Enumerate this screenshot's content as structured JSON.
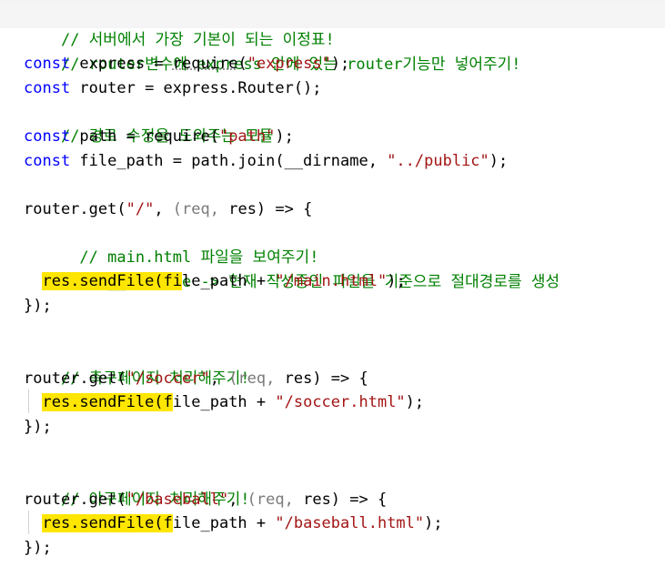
{
  "colors": {
    "background": "#ffffff",
    "comment": "#008000",
    "keyword": "#0000ff",
    "string": "#a31515",
    "plain": "#000000",
    "faded_param": "#7a7a7a",
    "highlight": "#ffe600"
  },
  "code": {
    "l1": {
      "comment": "// 서버에서 가장 기본이 되는 이정표!"
    },
    "l2": {
      "comment": "// router변수에 express 안에 있는 router기능만 넣어주기!"
    },
    "l3": {
      "kw": "const",
      "a": " express = ",
      "b": "require",
      "c": "(",
      "str": "\"express\"",
      "d": ");"
    },
    "l4": {
      "kw": "const",
      "a": " router = express.Router();"
    },
    "l5": {
      "comment": "// 경로 수정을 도와주는 모듈"
    },
    "l6": {
      "kw": "const",
      "a": " path = require(",
      "str": "\"path\"",
      "b": ");"
    },
    "l7": {
      "kw": "const",
      "a": " file_path = path.join(__dirname, ",
      "str": "\"../public\"",
      "b": ");"
    },
    "l9": {
      "a": "router.get(",
      "str": "\"/\"",
      "b": ", ",
      "c": "(req, ",
      "d": "res) => {"
    },
    "l10": {
      "comment": "  // main.html 파일을 보여주기!"
    },
    "l11": {
      "comment": "  // __dirname -> 현재 작성중인 파일을 기준으로 절대경로를 생성"
    },
    "l12": {
      "pre": "  ",
      "hl": "res.sendFile(fi",
      "a": "le_path + ",
      "str": "\"/main.html\"",
      "b": ");"
    },
    "l13": {
      "a": "});"
    },
    "l15": {
      "comment": "// 축구페이지 처리해주기!"
    },
    "l16": {
      "a": "router.get(",
      "str": "\"/soccer\"",
      "b": ", ",
      "c": "(req, ",
      "d": "res) => {"
    },
    "l17": {
      "pre": "  ",
      "hl": "res.sendFile(f",
      "a": "ile_path + ",
      "str": "\"/soccer.html\"",
      "b": ");"
    },
    "l18": {
      "a": "});"
    },
    "l20": {
      "comment": "// 야구페이지 처리해주기!"
    },
    "l21": {
      "a": "router.get(",
      "str": "\"/baseball\"",
      "b": ", ",
      "c": "(req, ",
      "d": "res) => {"
    },
    "l22": {
      "pre": "  ",
      "hl": "res.sendFile(f",
      "a": "ile_path + ",
      "str": "\"/baseball.html\"",
      "b": ");"
    },
    "l23": {
      "a": "});"
    }
  }
}
